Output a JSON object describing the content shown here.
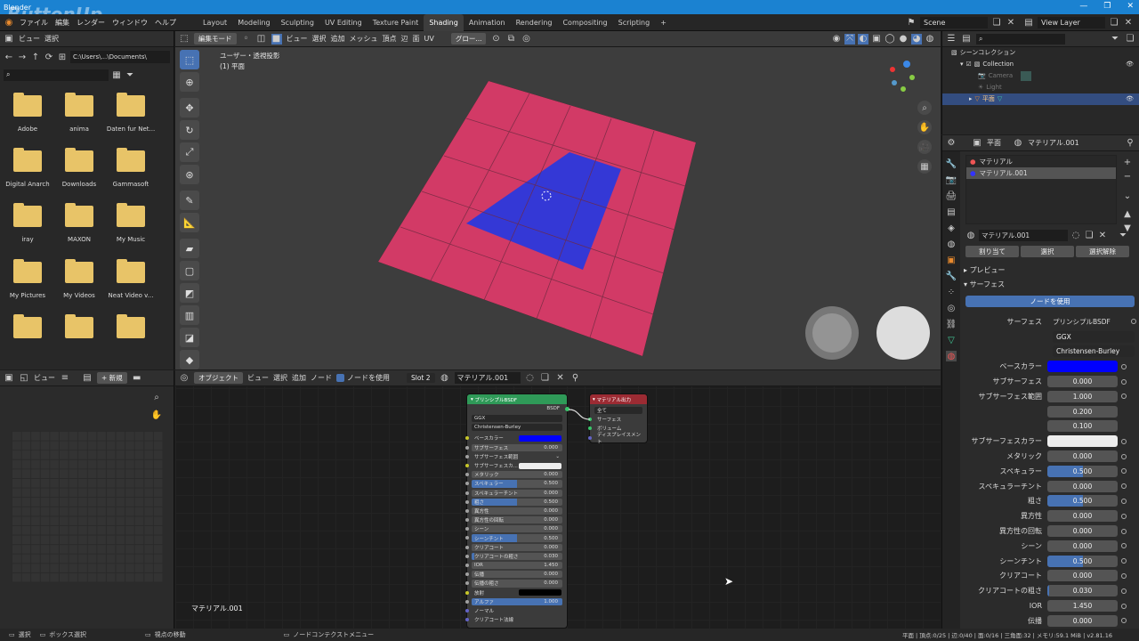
{
  "window": {
    "title": "Blender",
    "watermark": "ButtonUp"
  },
  "menubar": {
    "items": [
      "ファイル",
      "編集",
      "レンダー",
      "ウィンドウ",
      "ヘルプ"
    ],
    "tabs": [
      "Layout",
      "Modeling",
      "Sculpting",
      "UV Editing",
      "Texture Paint",
      "Shading",
      "Animation",
      "Rendering",
      "Compositing",
      "Scripting"
    ],
    "active_tab": "Shading",
    "scene": "Scene",
    "view_layer": "View Layer"
  },
  "filebrowser": {
    "header": [
      "ビュー",
      "選択"
    ],
    "path": "C:\\Users\\...\\Documents\\",
    "folders": [
      "Adobe",
      "anima",
      "Daten fur Net...",
      "Digital Anarch",
      "Downloads",
      "Gammasoft",
      "iray",
      "MAXON",
      "My Music",
      "My Pictures",
      "My Videos",
      "Neat Video v...",
      "",
      "",
      ""
    ]
  },
  "viewport": {
    "header": [
      "編集モード",
      "ビュー",
      "選択",
      "追加",
      "メッシュ",
      "頂点",
      "辺",
      "面",
      "UV"
    ],
    "orientation": "グロー...",
    "label1": "ユーザー・透視投影",
    "label2": "(1) 平面",
    "colors": {
      "bg": "#3d3d3d",
      "pink": "#d23a66",
      "blue": "#3438d6"
    }
  },
  "image_editor": {
    "header": [
      "ビュー",
      "新規"
    ]
  },
  "node_editor": {
    "header": [
      "オブジェクト",
      "ビュー",
      "選択",
      "追加",
      "ノード",
      "ノードを使用"
    ],
    "slot": "Slot 2",
    "material": "マテリアル.001",
    "footer_label": "マテリアル.001",
    "bsdf": {
      "title": "プリンシプルBSDF",
      "out": "BSDF",
      "dist": "GGX",
      "sss_method": "Christensen-Burley",
      "rows": [
        {
          "label": "ベースカラー",
          "value": "",
          "kind": "color",
          "color": "#0000ff"
        },
        {
          "label": "サブサーフェス",
          "value": "0.000",
          "fill": 0
        },
        {
          "label": "サブサーフェス範囲",
          "value": "",
          "kind": "menu"
        },
        {
          "label": "サブサーフェスカ...",
          "value": "",
          "kind": "color",
          "color": "#eeeeee"
        },
        {
          "label": "メタリック",
          "value": "0.000",
          "fill": 0
        },
        {
          "label": "スペキュラー",
          "value": "0.500",
          "fill": 0.5
        },
        {
          "label": "スペキュラーチント",
          "value": "0.000",
          "fill": 0
        },
        {
          "label": "粗さ",
          "value": "0.500",
          "fill": 0.5
        },
        {
          "label": "異方性",
          "value": "0.000",
          "fill": 0
        },
        {
          "label": "異方性の回転",
          "value": "0.000",
          "fill": 0
        },
        {
          "label": "シーン",
          "value": "0.000",
          "fill": 0
        },
        {
          "label": "シーンチント",
          "value": "0.500",
          "fill": 0.5
        },
        {
          "label": "クリアコート",
          "value": "0.000",
          "fill": 0
        },
        {
          "label": "クリアコートの粗さ",
          "value": "0.030",
          "fill": 0.03
        },
        {
          "label": "IOR",
          "value": "1.450",
          "fill": 0
        },
        {
          "label": "伝播",
          "value": "0.000",
          "fill": 0
        },
        {
          "label": "伝播の粗さ",
          "value": "0.000",
          "fill": 0
        },
        {
          "label": "放射",
          "value": "",
          "kind": "color",
          "color": "#000000"
        },
        {
          "label": "アルファ",
          "value": "1.000",
          "fill": 1
        },
        {
          "label": "ノーマル",
          "value": "",
          "kind": "plain"
        },
        {
          "label": "クリアコート法線",
          "value": "",
          "kind": "plain"
        }
      ]
    },
    "output": {
      "title": "マテリアル出力",
      "target": "全て",
      "inputs": [
        "サーフェス",
        "ボリューム",
        "ディスプレイスメント"
      ]
    }
  },
  "outliner": {
    "title": "シーンコレクション",
    "items": [
      "Collection",
      "Camera",
      "Light",
      "平面"
    ]
  },
  "properties": {
    "object": "平面",
    "material_label": "マテリアル.001",
    "slots": [
      "マテリアル",
      "マテリアル.001"
    ],
    "mat_name": "マテリアル.001",
    "buttons": [
      "割り当て",
      "選択",
      "選択解除"
    ],
    "sections": [
      "プレビュー",
      "サーフェス"
    ],
    "use_nodes": "ノードを使用",
    "surface_label": "サーフェス",
    "surface_value": "プリンシプルBSDF",
    "dist": "GGX",
    "sss_method": "Christensen-Burley",
    "rows": [
      {
        "label": "ベースカラー",
        "kind": "color",
        "color": "#0000ff",
        "value": ""
      },
      {
        "label": "サブサーフェス",
        "value": "0.000",
        "fill": 0
      },
      {
        "label": "サブサーフェス範囲",
        "kind": "vector",
        "values": [
          "1.000",
          "0.200",
          "0.100"
        ]
      },
      {
        "label": "サブサーフェスカラー",
        "kind": "color",
        "color": "#eeeeee",
        "value": ""
      },
      {
        "label": "メタリック",
        "value": "0.000",
        "fill": 0
      },
      {
        "label": "スペキュラー",
        "value": "0.500",
        "fill": 0.5
      },
      {
        "label": "スペキュラーチント",
        "value": "0.000",
        "fill": 0
      },
      {
        "label": "粗さ",
        "value": "0.500",
        "fill": 0.5
      },
      {
        "label": "異方性",
        "value": "0.000",
        "fill": 0
      },
      {
        "label": "異方性の回転",
        "value": "0.000",
        "fill": 0
      },
      {
        "label": "シーン",
        "value": "0.000",
        "fill": 0
      },
      {
        "label": "シーンチント",
        "value": "0.500",
        "fill": 0.5
      },
      {
        "label": "クリアコート",
        "value": "0.000",
        "fill": 0
      },
      {
        "label": "クリアコートの粗さ",
        "value": "0.030",
        "fill": 0.03
      },
      {
        "label": "IOR",
        "value": "1.450",
        "fill": 0
      },
      {
        "label": "伝播",
        "value": "0.000",
        "fill": 0
      }
    ]
  },
  "statusbar": {
    "left1": "選択",
    "left2": "ボックス選択",
    "mid1": "視点の移動",
    "mid2": "ノードコンテクストメニュー",
    "right": "平面 | 頂点:0/25 | 辺:0/40 | 面:0/16 | 三角面:32 | メモリ:59.1 MiB | v2.81.16"
  }
}
